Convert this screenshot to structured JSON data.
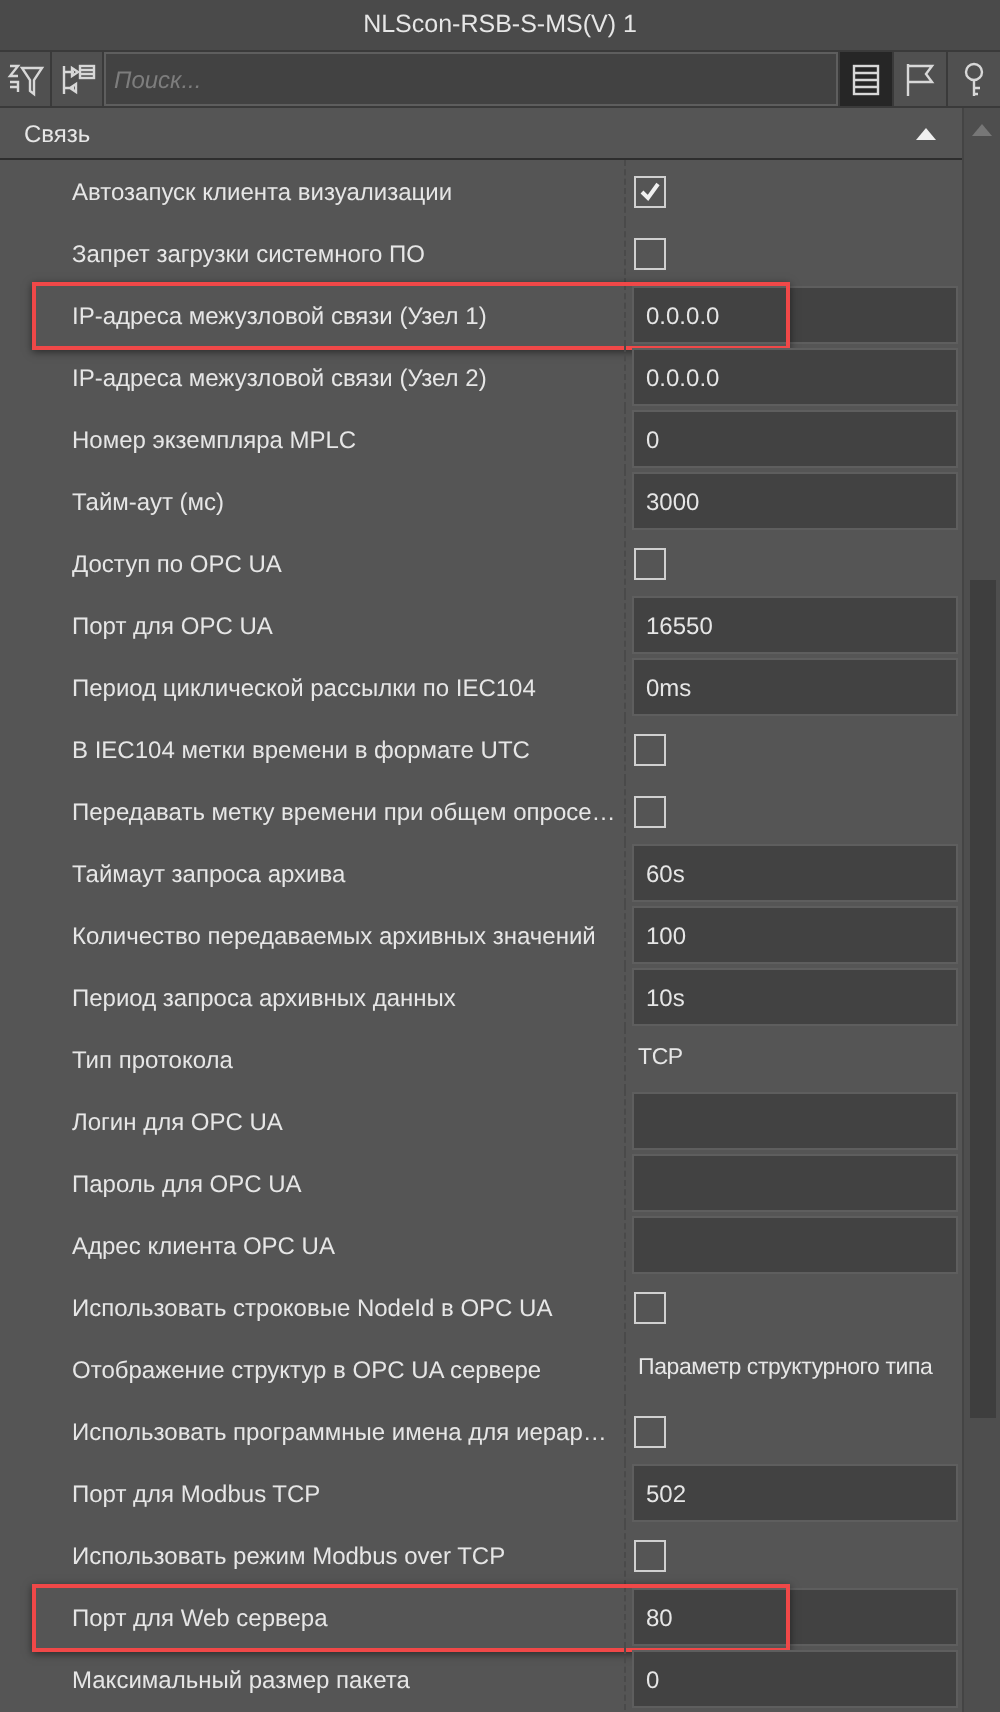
{
  "window": {
    "title": "NLScon-RSB-S-MS(V) 1"
  },
  "toolbar": {
    "left_buttons": [
      {
        "kind": "sort-filter"
      },
      {
        "kind": "expand"
      }
    ],
    "search": {
      "placeholder": "Поиск..."
    },
    "right_buttons": [
      {
        "kind": "list",
        "selected": true
      },
      {
        "kind": "flag",
        "selected": false
      },
      {
        "kind": "key",
        "selected": false
      }
    ]
  },
  "section": {
    "title": "Связь",
    "expanded": true
  },
  "rows": [
    {
      "label": "Автозапуск клиента визуализации",
      "kind": "checkbox",
      "checked": true,
      "highlighted": false
    },
    {
      "label": "Запрет загрузки системного ПО",
      "kind": "checkbox",
      "checked": false,
      "highlighted": false
    },
    {
      "label": "IP-адреса межузловой связи (Узел 1)",
      "kind": "input",
      "value": "0.0.0.0",
      "highlighted": true
    },
    {
      "label": "IP-адреса межузловой связи (Узел 2)",
      "kind": "input",
      "value": "0.0.0.0",
      "highlighted": false
    },
    {
      "label": "Номер экземпляра MPLC",
      "kind": "input",
      "value": "0",
      "highlighted": false
    },
    {
      "label": "Тайм-аут (мс)",
      "kind": "input",
      "value": "3000",
      "highlighted": false
    },
    {
      "label": "Доступ по OPC UA",
      "kind": "checkbox",
      "checked": false,
      "highlighted": false
    },
    {
      "label": "Порт для OPC UA",
      "kind": "input",
      "value": "16550",
      "highlighted": false
    },
    {
      "label": "Период циклической рассылки по IEC104",
      "kind": "input",
      "value": "0ms",
      "highlighted": false
    },
    {
      "label": "В IEC104 метки времени в формате UTC",
      "kind": "checkbox",
      "checked": false,
      "highlighted": false
    },
    {
      "label": "Передавать метку времени при общем опросе…",
      "kind": "checkbox",
      "checked": false,
      "highlighted": false
    },
    {
      "label": "Таймаут запроса архива",
      "kind": "input",
      "value": "60s",
      "highlighted": false
    },
    {
      "label": "Количество передаваемых архивных значений",
      "kind": "input",
      "value": "100",
      "highlighted": false
    },
    {
      "label": "Период запроса архивных данных",
      "kind": "input",
      "value": "10s",
      "highlighted": false
    },
    {
      "label": "Тип протокола",
      "kind": "text",
      "value": "TCP",
      "highlighted": false
    },
    {
      "label": "Логин для OPC UA",
      "kind": "input",
      "value": "",
      "highlighted": false
    },
    {
      "label": "Пароль для OPC UA",
      "kind": "input",
      "value": "",
      "highlighted": false
    },
    {
      "label": "Адрес клиента OPC UA",
      "kind": "input",
      "value": "",
      "highlighted": false
    },
    {
      "label": "Использовать строковые NodeId в OPC UA",
      "kind": "checkbox",
      "checked": false,
      "highlighted": false
    },
    {
      "label": "Отображение структур в OPC UA сервере",
      "kind": "text",
      "value": "Параметр структурного типа",
      "highlighted": false
    },
    {
      "label": "Использовать программные имена для иерар…",
      "kind": "checkbox",
      "checked": false,
      "highlighted": false
    },
    {
      "label": "Порт для Modbus TCP",
      "kind": "input",
      "value": "502",
      "highlighted": false
    },
    {
      "label": "Использовать режим Modbus over TCP",
      "kind": "checkbox",
      "checked": false,
      "highlighted": false
    },
    {
      "label": "Порт для Web сервера",
      "kind": "input",
      "value": "80",
      "highlighted": true
    },
    {
      "label": "Максимальный размер пакета",
      "kind": "input",
      "value": "0",
      "highlighted": false
    }
  ]
}
